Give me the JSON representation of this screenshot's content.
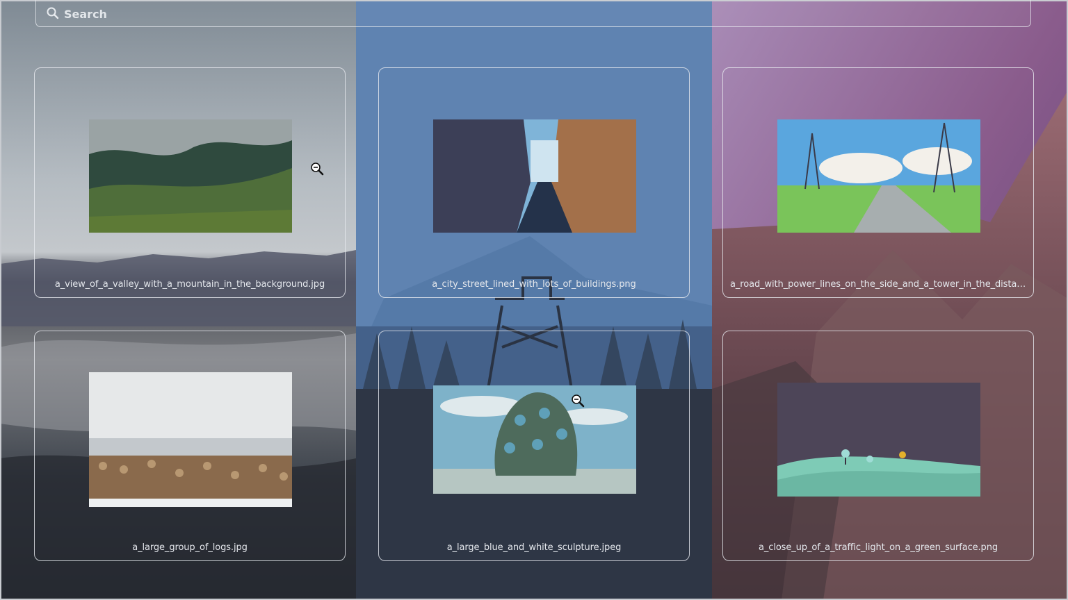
{
  "search": {
    "placeholder": "Search",
    "value": ""
  },
  "icons": {
    "search": "search-icon",
    "cursor": "zoom-out-cursor-icon"
  },
  "colors": {
    "panel_left": "#8e99a4",
    "panel_mid": "#5f83b1",
    "panel_right": "#9f7ba6",
    "card_border": "#e8ebf0",
    "caption_text": "#e4e7ec"
  },
  "wallpapers": [
    {
      "filename": "a_view_of_a_valley_with_a_mountain_in_the_background.jpg"
    },
    {
      "filename": "a_city_street_lined_with_lots_of_buildings.png"
    },
    {
      "filename": "a_road_with_power_lines_on_the_side_and_a_tower_in_the_distance.png"
    },
    {
      "filename": "a_large_group_of_logs.jpg"
    },
    {
      "filename": "a_large_blue_and_white_sculpture.jpeg"
    },
    {
      "filename": "a_close_up_of_a_traffic_light_on_a_green_surface.png"
    }
  ]
}
